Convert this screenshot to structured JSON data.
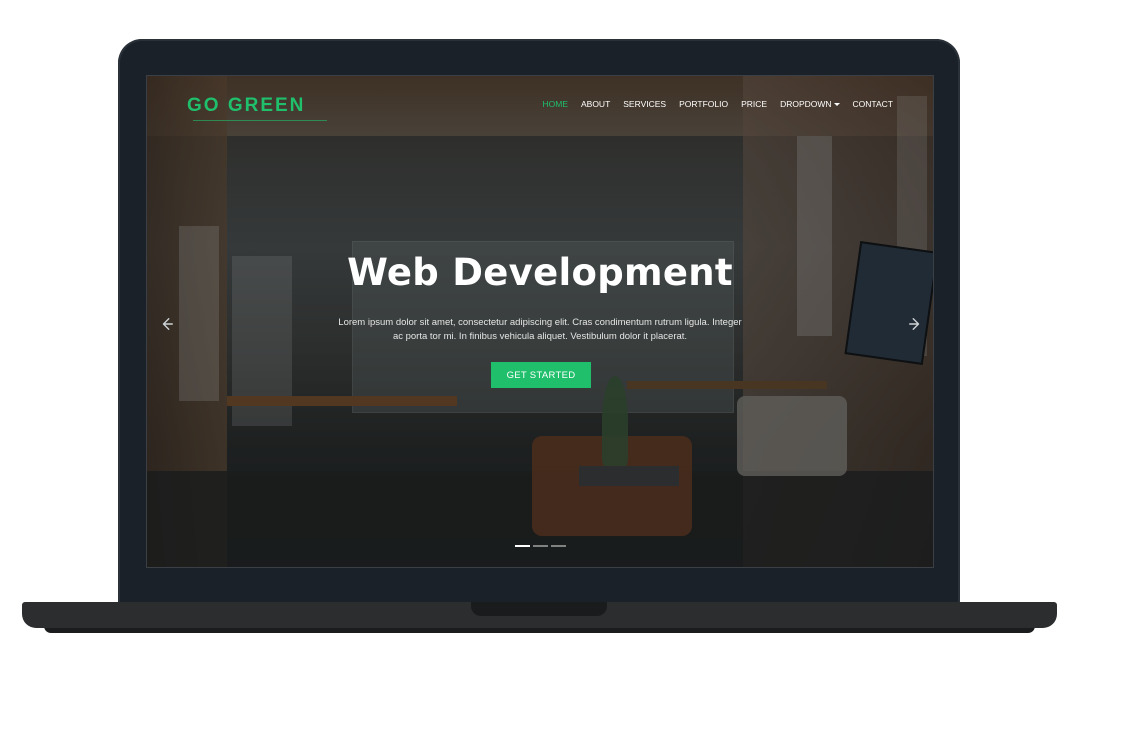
{
  "brand": {
    "name": "GO GREEN"
  },
  "nav": {
    "items": [
      {
        "label": "HOME"
      },
      {
        "label": "ABOUT"
      },
      {
        "label": "SERVICES"
      },
      {
        "label": "PORTFOLIO"
      },
      {
        "label": "PRICE"
      },
      {
        "label": "DROPDOWN"
      },
      {
        "label": "CONTACT"
      }
    ],
    "active": "HOME"
  },
  "hero": {
    "title": "Web Development",
    "text": "Lorem ipsum dolor sit amet, consectetur adipiscing elit. Cras condimentum rutrum ligula. Integer ac porta tor mi. In finibus vehicula aliquet. Vestibulum dolor it placerat.",
    "button": "GET STARTED",
    "slides": 3,
    "active_slide": 1
  },
  "icons": {
    "prev": "arrow-left-icon",
    "next": "arrow-right-icon",
    "dropdown": "caret-down-icon"
  },
  "colors": {
    "accent": "#1fbf6b",
    "frame": "#1a2128",
    "base": "#2b2d2f"
  }
}
